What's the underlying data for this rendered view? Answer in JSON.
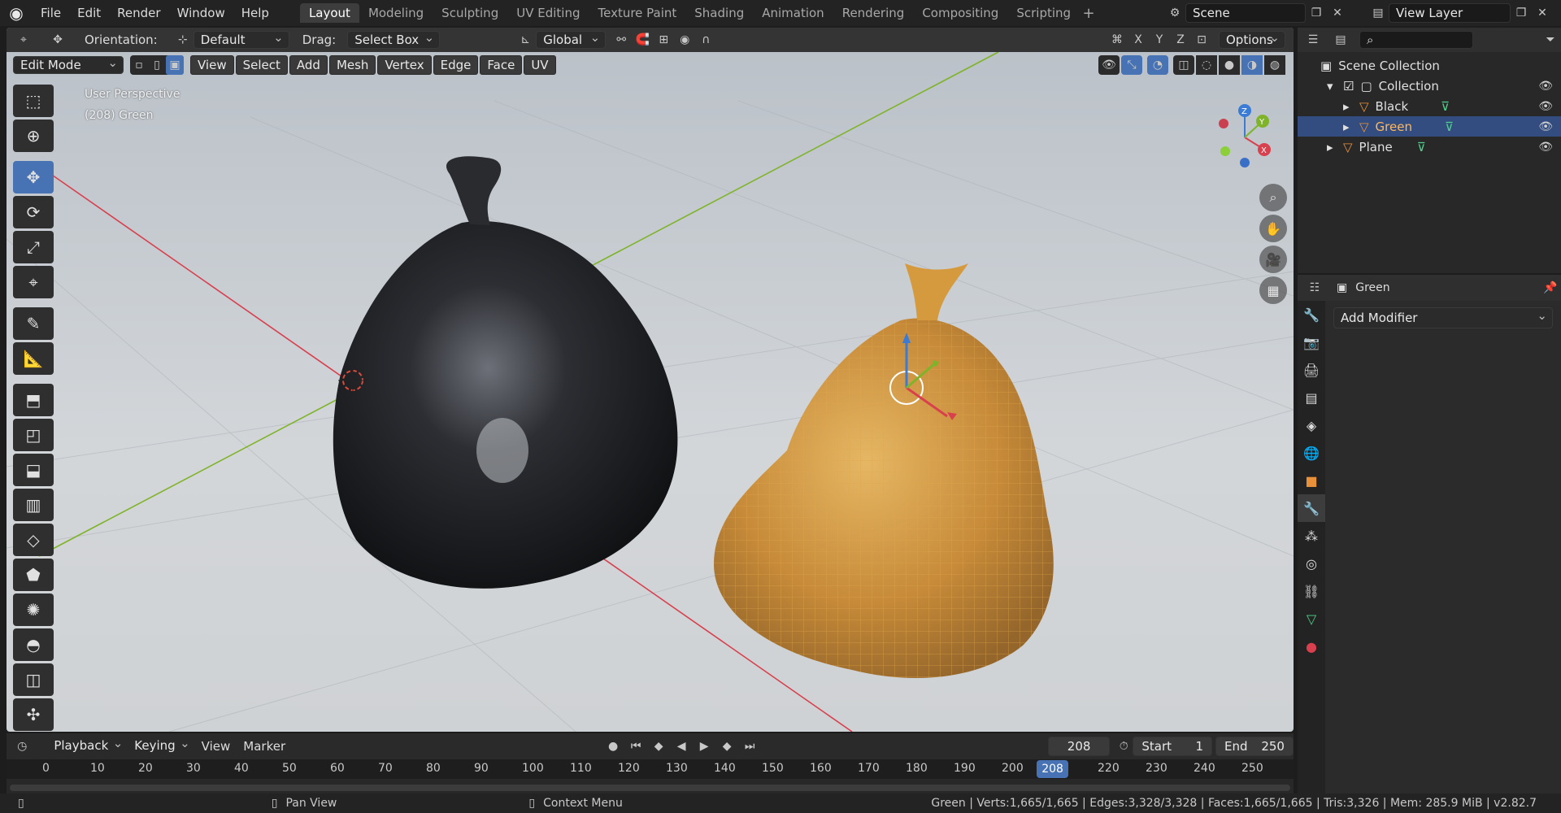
{
  "topbar": {
    "menus": [
      "File",
      "Edit",
      "Render",
      "Window",
      "Help"
    ],
    "workspaces": [
      "Layout",
      "Modeling",
      "Sculpting",
      "UV Editing",
      "Texture Paint",
      "Shading",
      "Animation",
      "Rendering",
      "Compositing",
      "Scripting"
    ],
    "active_workspace": "Layout",
    "add_workspace": "+",
    "scene": "Scene",
    "view_layer": "View Layer"
  },
  "viewport": {
    "orientation_label": "Orientation:",
    "orientation_value": "Default",
    "drag_label": "Drag:",
    "drag_value": "Select Box",
    "transform_space": "Global",
    "options": "Options",
    "mode": "Edit Mode",
    "menus": [
      "View",
      "Select",
      "Add",
      "Mesh",
      "Vertex",
      "Edge",
      "Face",
      "UV"
    ],
    "axis_buttons": [
      "X",
      "Y",
      "Z"
    ],
    "overlay_line1": "User Perspective",
    "overlay_line2": "(208) Green",
    "gizmo_axes": {
      "x": "X",
      "y": "Y",
      "z": "Z"
    }
  },
  "outliner": {
    "root": "Scene Collection",
    "items": [
      {
        "label": "Collection"
      },
      {
        "label": "Black"
      },
      {
        "label": "Green"
      },
      {
        "label": "Plane"
      }
    ]
  },
  "properties": {
    "object_name": "Green",
    "add_modifier": "Add Modifier"
  },
  "timeline": {
    "menus": [
      "Playback",
      "Keying",
      "View",
      "Marker"
    ],
    "current_frame": "208",
    "start_label": "Start",
    "start": "1",
    "end_label": "End",
    "end": "250",
    "ticks": [
      "0",
      "10",
      "20",
      "30",
      "40",
      "50",
      "60",
      "70",
      "80",
      "90",
      "100",
      "110",
      "120",
      "130",
      "140",
      "150",
      "160",
      "170",
      "180",
      "190",
      "200",
      "220",
      "230",
      "240",
      "250"
    ]
  },
  "statusbar": {
    "pan": "Pan View",
    "context": "Context Menu",
    "stats": "Green | Verts:1,665/1,665 | Edges:3,328/3,328 | Faces:1,665/1,665 | Tris:3,326 | Mem: 285.9 MiB | v2.82.7"
  },
  "colors": {
    "accent": "#4772b3",
    "x_axis": "#d8404e",
    "y_axis": "#7fb32a",
    "z_axis": "#3a7bd5"
  }
}
